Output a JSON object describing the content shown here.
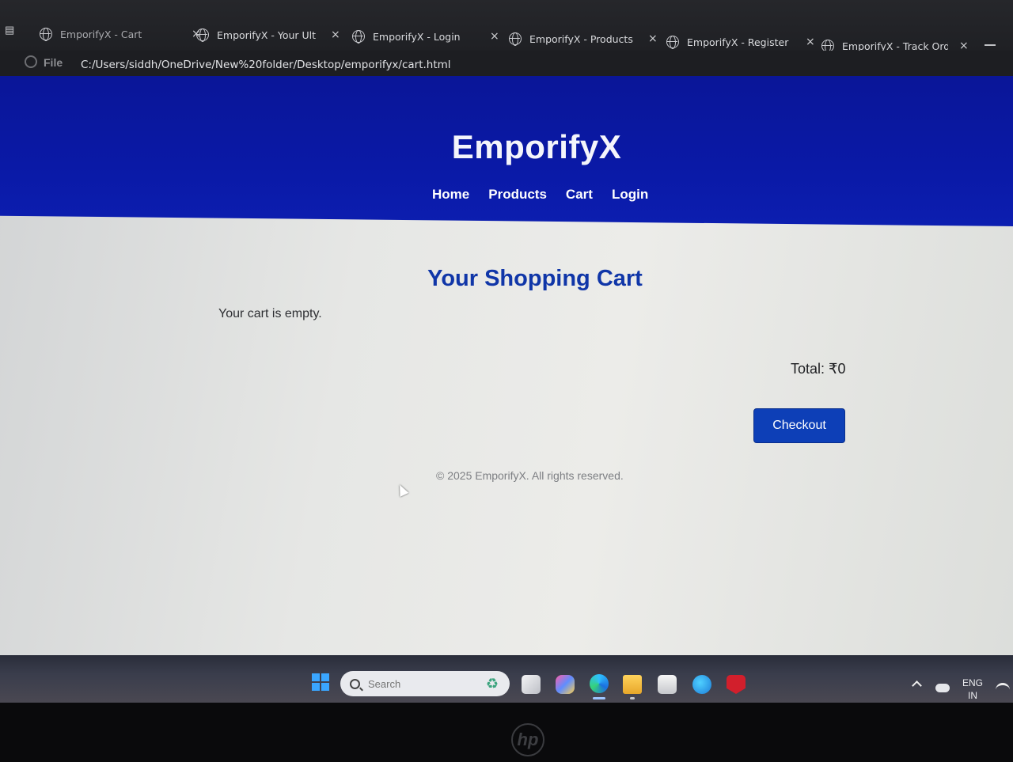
{
  "browser": {
    "tabs": [
      {
        "label": "EmporifyX - Cart"
      },
      {
        "label": "EmporifyX - Your Ultimate"
      },
      {
        "label": "EmporifyX - Login"
      },
      {
        "label": "EmporifyX - Products"
      },
      {
        "label": "EmporifyX - Register"
      },
      {
        "label": "EmporifyX - Track Order"
      }
    ],
    "close_glyph": "×",
    "address": {
      "scheme_label": "File",
      "url": "C:/Users/siddh/OneDrive/New%20folder/Desktop/emporifyx/cart.html"
    }
  },
  "site": {
    "brand": "EmporifyX",
    "nav": [
      "Home",
      "Products",
      "Cart",
      "Login"
    ],
    "colors": {
      "header": "#0a19a6",
      "accent": "#1036a8",
      "button": "#0d3fb7"
    }
  },
  "cart": {
    "title": "Your Shopping Cart",
    "empty_message": "Your cart is empty.",
    "total_label": "Total: ₹0",
    "checkout_label": "Checkout"
  },
  "footer": {
    "text": "© 2025 EmporifyX. All rights reserved."
  },
  "taskbar": {
    "search_placeholder": "Search",
    "icons": [
      "windows-start-icon",
      "task-view-icon",
      "copilot-icon",
      "edge-icon",
      "file-explorer-icon",
      "store-icon",
      "help-icon",
      "mcafee-icon"
    ],
    "lang_line1": "ENG",
    "lang_line2": "IN"
  },
  "device": {
    "logo": "hp"
  }
}
